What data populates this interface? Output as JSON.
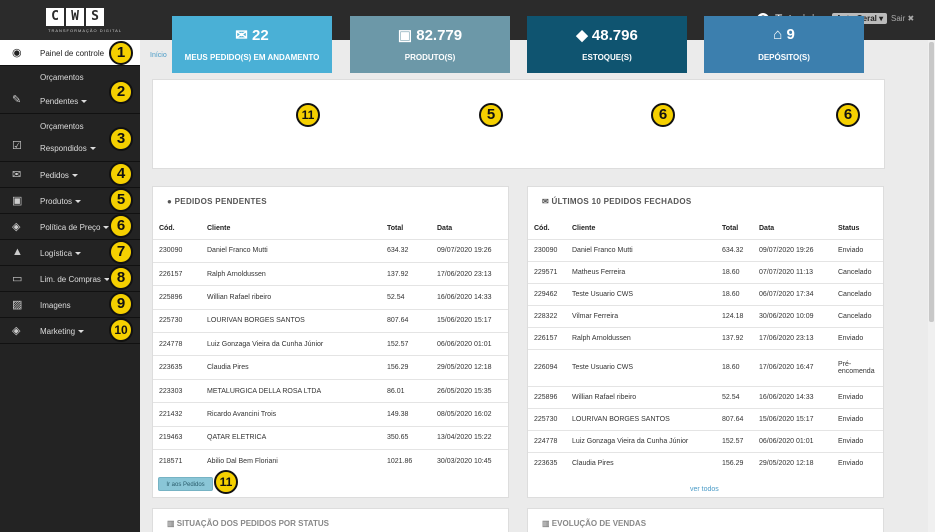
{
  "header": {
    "logo_letters": [
      "C",
      "W",
      "S"
    ],
    "logo_sub": "TRANSFORMAÇÃO DIGITAL",
    "tutoriais": "Tutoriais",
    "user_select": "Auto Geral",
    "sair": "Sair ✖"
  },
  "sidebar": {
    "painel": "Painel de controle",
    "orc_pend_1": "Orçamentos",
    "orc_pend_2": "Pendentes",
    "orc_resp_1": "Orçamentos",
    "orc_resp_2": "Respondidos",
    "pedidos": "Pedidos",
    "produtos": "Produtos",
    "politica": "Política de Preço",
    "logistica": "Logística",
    "lim_compras": "Lim. de Compras",
    "imagens": "Imagens",
    "marketing": "Marketing"
  },
  "badges": [
    "1",
    "2",
    "3",
    "4",
    "5",
    "6",
    "7",
    "8",
    "9",
    "10",
    "11",
    "5",
    "6",
    "6",
    "11"
  ],
  "breadcrumb": "Início",
  "stats": [
    {
      "value": "22",
      "caption": "MEUS PEDIDO(S) EM ANDAMENTO",
      "color": "#4ab0d6"
    },
    {
      "value": "82.779",
      "caption": "PRODUTO(S)",
      "color": "#6c98a8"
    },
    {
      "value": "48.796",
      "caption": "ESTOQUE(S)",
      "color": "#0f5470"
    },
    {
      "value": "9",
      "caption": "DEPÓSITO(S)",
      "color": "#3c7fae"
    }
  ],
  "pendentes": {
    "title": "PEDIDOS PENDENTES",
    "headers": [
      "Cód.",
      "Cliente",
      "Total",
      "Data"
    ],
    "rows": [
      [
        "230090",
        "Daniel Franco Mutti",
        "634.32",
        "09/07/2020 19:26"
      ],
      [
        "226157",
        "Ralph Arnoldussen",
        "137.92",
        "17/06/2020 23:13"
      ],
      [
        "225896",
        "Willian Rafael ribeiro",
        "52.54",
        "16/06/2020 14:33"
      ],
      [
        "225730",
        "LOURIVAN BORGES SANTOS",
        "807.64",
        "15/06/2020 15:17"
      ],
      [
        "224778",
        "Luiz Gonzaga Vieira da Cunha Júnior",
        "152.57",
        "06/06/2020 01:01"
      ],
      [
        "223635",
        "Claudia Pires",
        "156.29",
        "29/05/2020 12:18"
      ],
      [
        "223303",
        "METALURGICA DELLA ROSA LTDA",
        "86.01",
        "26/05/2020 15:35"
      ],
      [
        "221432",
        "Ricardo Avancini Trois",
        "149.38",
        "08/05/2020 16:02"
      ],
      [
        "219463",
        "QATAR ELETRICA",
        "350.65",
        "13/04/2020 15:22"
      ],
      [
        "218571",
        "Abilio Dal Bem Floriani",
        "1021.86",
        "30/03/2020 10:45"
      ]
    ],
    "button": "Ir aos Pedidos"
  },
  "fechados": {
    "title": "ÚLTIMOS 10 PEDIDOS FECHADOS",
    "headers": [
      "Cód.",
      "Cliente",
      "Total",
      "Data",
      "Status"
    ],
    "rows": [
      [
        "230090",
        "Daniel Franco Mutti",
        "634.32",
        "09/07/2020 19:26",
        "Enviado"
      ],
      [
        "229571",
        "Matheus Ferreira",
        "18.60",
        "07/07/2020 11:13",
        "Cancelado"
      ],
      [
        "229462",
        "Teste Usuario CWS",
        "18.60",
        "06/07/2020 17:34",
        "Cancelado"
      ],
      [
        "228322",
        "Vilmar Ferreira",
        "124.18",
        "30/06/2020 10:09",
        "Cancelado"
      ],
      [
        "226157",
        "Ralph Arnoldussen",
        "137.92",
        "17/06/2020 23:13",
        "Enviado"
      ],
      [
        "226094",
        "Teste Usuario CWS",
        "18.60",
        "17/06/2020 16:47",
        "Pré-encomenda"
      ],
      [
        "225896",
        "Willian Rafael ribeiro",
        "52.54",
        "16/06/2020 14:33",
        "Enviado"
      ],
      [
        "225730",
        "LOURIVAN BORGES SANTOS",
        "807.64",
        "15/06/2020 15:17",
        "Enviado"
      ],
      [
        "224778",
        "Luiz Gonzaga Vieira da Cunha Júnior",
        "152.57",
        "06/06/2020 01:01",
        "Enviado"
      ],
      [
        "223635",
        "Claudia Pires",
        "156.29",
        "29/05/2020 12:18",
        "Enviado"
      ]
    ],
    "ver_todos": "ver todos"
  },
  "bottom": {
    "situacao": "SITUAÇÃO DOS PEDIDOS POR STATUS",
    "evolucao": "EVOLUÇÃO DE VENDAS"
  }
}
